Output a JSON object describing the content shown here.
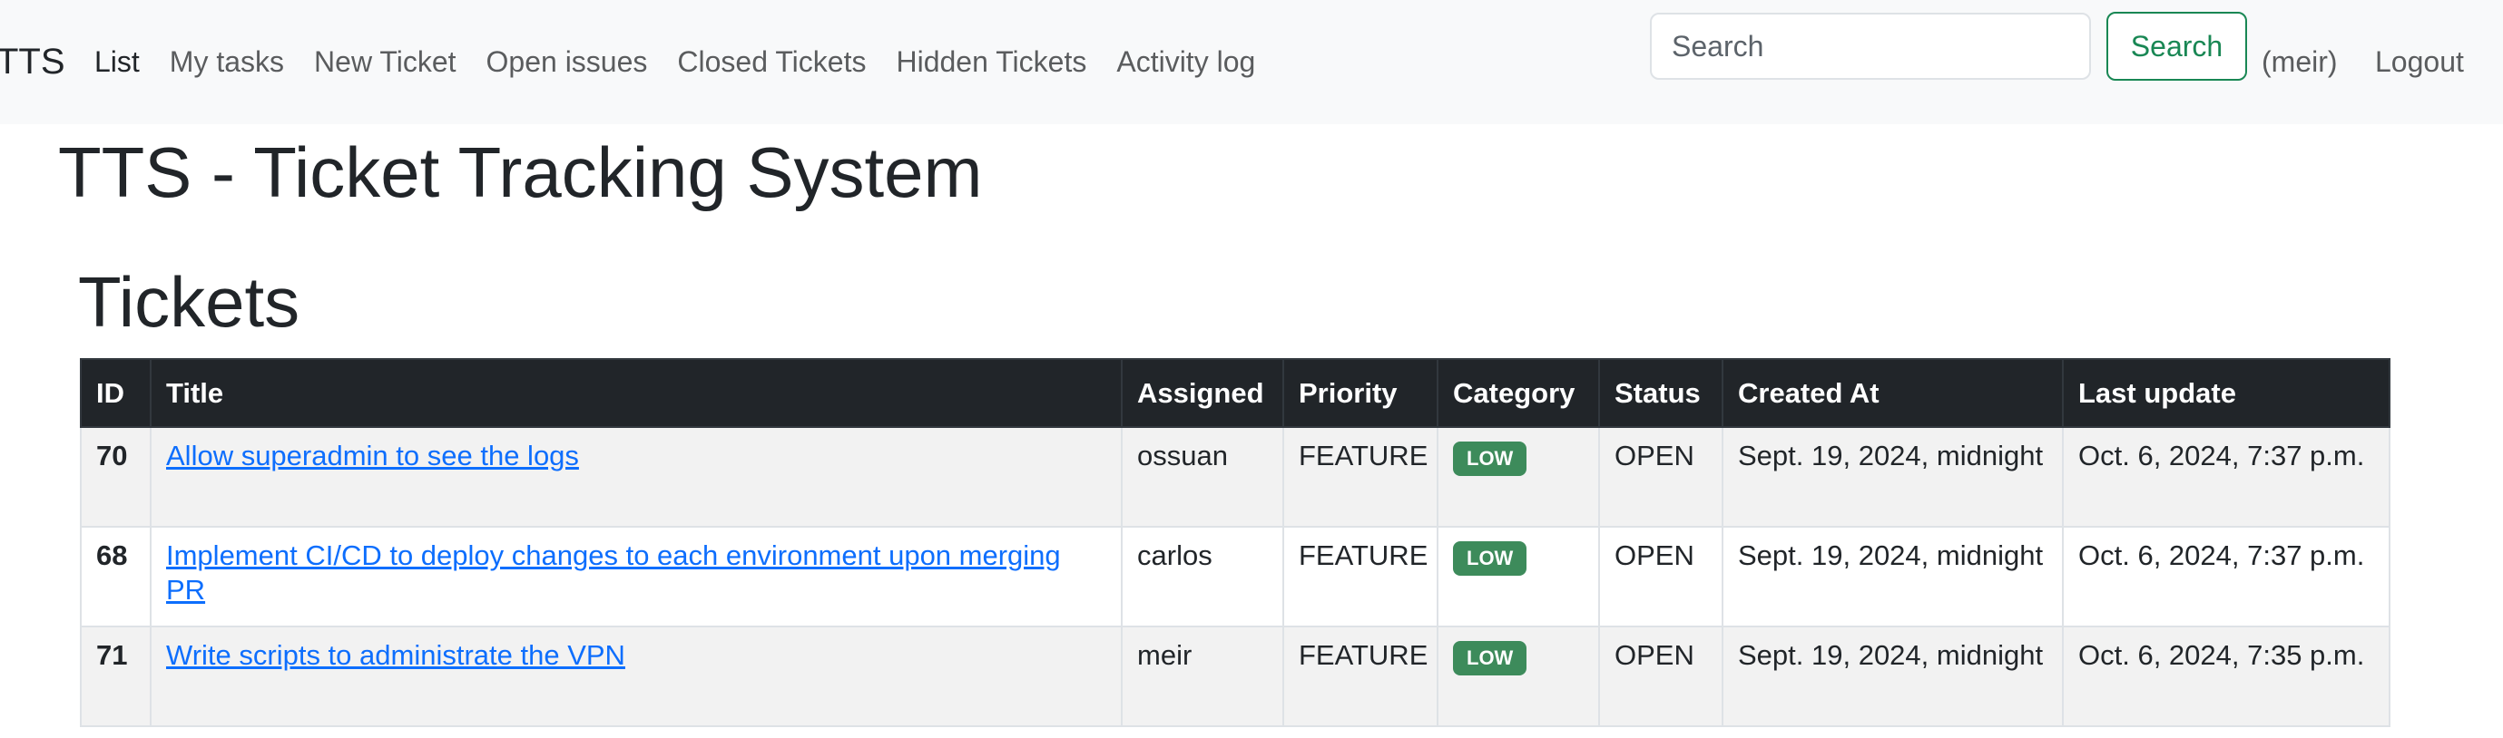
{
  "navbar": {
    "brand": "TTS",
    "links": [
      {
        "label": "List"
      },
      {
        "label": "My tasks"
      },
      {
        "label": "New Ticket"
      },
      {
        "label": "Open issues"
      },
      {
        "label": "Closed Tickets"
      },
      {
        "label": "Hidden Tickets"
      },
      {
        "label": "Activity log"
      }
    ],
    "search": {
      "placeholder": "Search",
      "value": "",
      "button_label": "Search"
    },
    "user": "(meir)",
    "logout": "Logout"
  },
  "page": {
    "title": "TTS - Ticket Tracking System",
    "section_title": "Tickets"
  },
  "table": {
    "headers": [
      "ID",
      "Title",
      "Assigned",
      "Priority",
      "Category",
      "Status",
      "Created At",
      "Last update"
    ],
    "rows": [
      {
        "id": "70",
        "title": "Allow superadmin to see the logs",
        "assigned": "ossuan",
        "priority": "FEATURE",
        "category": "LOW",
        "status": "OPEN",
        "created_at": "Sept. 19, 2024, midnight",
        "last_update": "Oct. 6, 2024, 7:37 p.m."
      },
      {
        "id": "68",
        "title": "Implement CI/CD to deploy changes to each environment upon merging PR",
        "assigned": "carlos",
        "priority": "FEATURE",
        "category": "LOW",
        "status": "OPEN",
        "created_at": "Sept. 19, 2024, midnight",
        "last_update": "Oct. 6, 2024, 7:37 p.m."
      },
      {
        "id": "71",
        "title": "Write scripts to administrate the VPN",
        "assigned": "meir",
        "priority": "FEATURE",
        "category": "LOW",
        "status": "OPEN",
        "created_at": "Sept. 19, 2024, midnight",
        "last_update": "Oct. 6, 2024, 7:35 p.m."
      }
    ]
  },
  "colors": {
    "navbar_bg": "#f8f9fa",
    "table_header_bg": "#212529",
    "link": "#0d6efd",
    "search_button": "#198754",
    "badge_low": "#3d8b5b"
  }
}
